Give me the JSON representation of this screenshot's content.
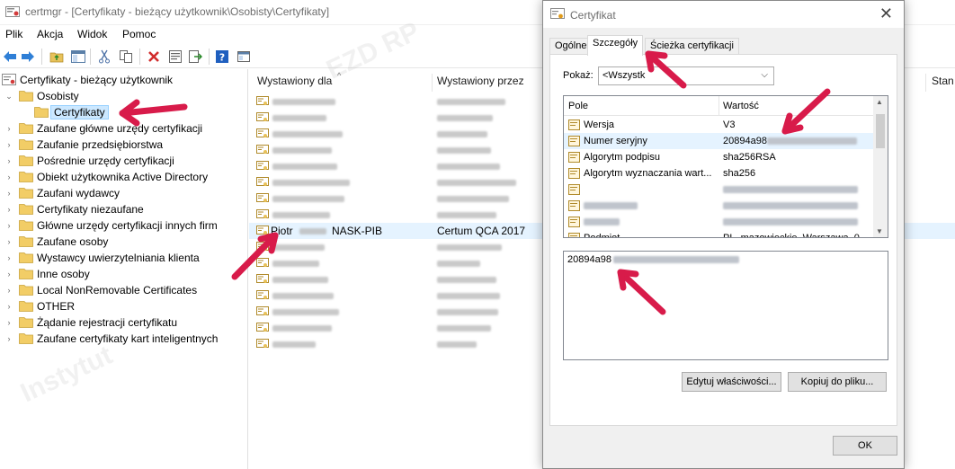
{
  "window": {
    "title": "certmgr - [Certyfikaty - bieżący użytkownik\\Osobisty\\Certyfikaty]"
  },
  "menu": [
    "Plik",
    "Akcja",
    "Widok",
    "Pomoc"
  ],
  "toolbar_icons": [
    "back-icon",
    "forward-icon",
    "up-folder-icon",
    "show-hide-tree-icon",
    "cut-icon",
    "copy-icon",
    "delete-icon",
    "properties-icon",
    "export-icon",
    "help-icon",
    "view-icon"
  ],
  "tree": {
    "root": "Certyfikaty - bieżący użytkownik",
    "items": [
      {
        "label": "Osobisty",
        "expanded": true
      },
      {
        "label": "Certyfikaty",
        "selected": true
      },
      {
        "label": "Zaufane główne urzędy certyfikacji"
      },
      {
        "label": "Zaufanie przedsiębiorstwa"
      },
      {
        "label": "Pośrednie urzędy certyfikacji"
      },
      {
        "label": "Obiekt użytkownika Active Directory"
      },
      {
        "label": "Zaufani wydawcy"
      },
      {
        "label": "Certyfikaty niezaufane"
      },
      {
        "label": "Główne urzędy certyfikacji innych firm"
      },
      {
        "label": "Zaufane osoby"
      },
      {
        "label": "Wystawcy uwierzytelniania klienta"
      },
      {
        "label": "Inne osoby"
      },
      {
        "label": "Local NonRemovable Certificates"
      },
      {
        "label": "OTHER"
      },
      {
        "label": "Żądanie rejestracji certyfikatu"
      },
      {
        "label": "Zaufane certyfikaty kart inteligentnych"
      }
    ]
  },
  "list": {
    "columns": [
      "Wystawiony dla",
      "Wystawiony przez",
      "Stan"
    ],
    "highlighted_row": {
      "issued_to_prefix": "Piotr",
      "issued_to_suffix": "NASK-PIB",
      "issued_by": "Certum QCA 2017"
    },
    "blurred_rows": 14
  },
  "dialog": {
    "title": "Certyfikat",
    "tabs": [
      "Ogólne",
      "Szczegóły",
      "Ścieżka certyfikacji"
    ],
    "active_tab": "Szczegóły",
    "show_label": "Pokaż:",
    "show_value": "<Wszystk",
    "fields_header": {
      "field": "Pole",
      "value": "Wartość"
    },
    "fields": [
      {
        "name": "Wersja",
        "value": "V3"
      },
      {
        "name": "Numer seryjny",
        "value": "20894a98",
        "selected": true
      },
      {
        "name": "Algorytm podpisu",
        "value": "sha256RSA"
      },
      {
        "name": "Algorytm wyznaczania wart...",
        "value": "sha256"
      },
      {
        "name": "",
        "value": ""
      },
      {
        "name": "",
        "value": ""
      },
      {
        "name": "",
        "value": ""
      },
      {
        "name": "Podmiot",
        "value": "PL, mazowieckie, Warszawa, 0..."
      }
    ],
    "value_box": "20894a98",
    "edit_button": "Edytuj właściwości...",
    "copy_button": "Kopiuj do pliku...",
    "ok_button": "OK"
  },
  "colors": {
    "annotation_arrow": "#d81b4a",
    "selection": "#cce8ff",
    "folder": "#e8c25a"
  }
}
